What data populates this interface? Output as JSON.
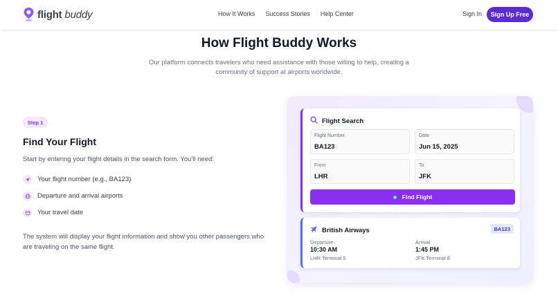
{
  "nav": {
    "logo_bold": "flight",
    "logo_light": " buddy",
    "links": [
      "How It Works",
      "Success Stories",
      "Help Center"
    ],
    "signin": "Sign In",
    "signup": "Sign Up Free"
  },
  "hero": {
    "title": "How Flight Buddy Works",
    "subtitle": "Our platform connects travelers who need assistance with those willing to help, creating a community of support at airports worldwide."
  },
  "step": {
    "badge": "Step 1",
    "title": "Find Your Flight",
    "description": "Start by entering your flight details in the search form. You'll need:",
    "requirements": [
      {
        "icon": "plane-icon",
        "text": "Your flight number (e.g., BA123)"
      },
      {
        "icon": "globe-icon",
        "text": "Departure and arrival airports"
      },
      {
        "icon": "calendar-icon",
        "text": "Your travel date"
      }
    ],
    "footer": "The system will display your flight information and show you other passengers who are traveling on the same flight."
  },
  "search": {
    "title": "Flight Search",
    "fields": {
      "flight_number": {
        "label": "Flight Number",
        "value": "BA123"
      },
      "date": {
        "label": "Date",
        "value": "Jun 15, 2025"
      },
      "from": {
        "label": "From",
        "value": "LHR"
      },
      "to": {
        "label": "To",
        "value": "JFK"
      }
    },
    "button": "Find Flight"
  },
  "flight": {
    "airline": "British Airways",
    "code": "BA123",
    "departure": {
      "label": "Departure",
      "time": "10:30 AM",
      "place": "LHR Terminal 5"
    },
    "arrival": {
      "label": "Arrival",
      "time": "1:45 PM",
      "place": "JFK Terminal 8"
    }
  },
  "colors": {
    "primary": "#5b2bd6",
    "accent": "#8b2ff0",
    "badge_bg": "#f3e8ff"
  }
}
